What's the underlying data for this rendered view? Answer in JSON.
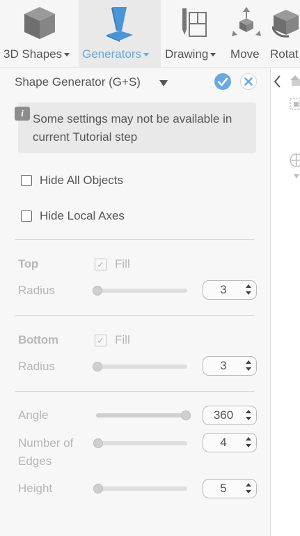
{
  "toolbar": {
    "items": [
      {
        "label": "3D Shapes",
        "has_menu": true,
        "active": false,
        "icon": "cube-icon"
      },
      {
        "label": "Generators",
        "has_menu": true,
        "active": true,
        "icon": "generator-prism-icon"
      },
      {
        "label": "Drawing",
        "has_menu": true,
        "active": false,
        "icon": "drawing-pencil-icon"
      },
      {
        "label": "Move",
        "has_menu": false,
        "active": false,
        "icon": "move-arrows-icon"
      },
      {
        "label": "Rotat",
        "has_menu": false,
        "active": false,
        "icon": "rotate-cube-icon"
      }
    ]
  },
  "panel": {
    "title": "Shape Generator (G+S)",
    "info_text": "Some settings may not be available in current Tutorial step",
    "hide_all_objects": {
      "label": "Hide All Objects",
      "checked": false
    },
    "hide_local_axes": {
      "label": "Hide Local Axes",
      "checked": false
    },
    "top": {
      "heading": "Top",
      "fill_label": "Fill",
      "fill_checked": true,
      "radius_label": "Radius",
      "radius_value": "3"
    },
    "bottom": {
      "heading": "Bottom",
      "fill_label": "Fill",
      "fill_checked": true,
      "radius_label": "Radius",
      "radius_value": "3"
    },
    "angle": {
      "label": "Angle",
      "value": "360",
      "slider_fraction": 1.0
    },
    "edges": {
      "label_line1": "Number of",
      "label_line2": "Edges",
      "value": "4",
      "slider_fraction": 0.0
    },
    "height": {
      "label": "Height",
      "value": "5",
      "slider_fraction": 0.0
    },
    "top_radius_slider_fraction": 0.0,
    "bottom_radius_slider_fraction": 0.0
  },
  "colors": {
    "accent": "#6aaae0",
    "active_label": "#6aa6dd",
    "disabled_text": "#b6b6b6"
  }
}
